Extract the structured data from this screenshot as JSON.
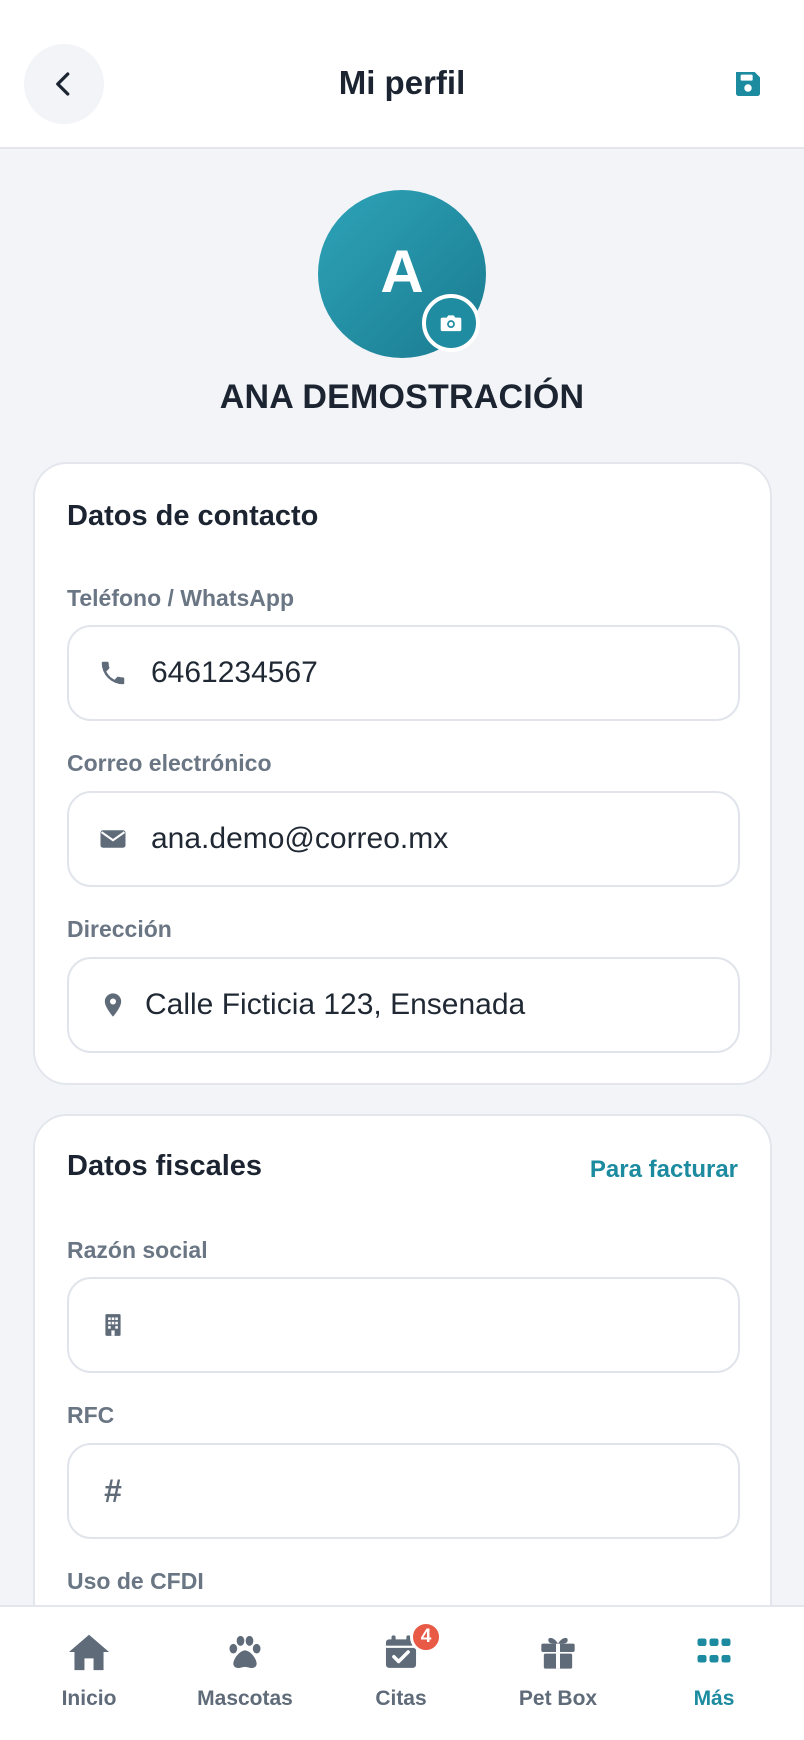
{
  "header": {
    "title": "Mi perfil",
    "back_icon": "chevron-left-icon",
    "save_icon": "save-icon"
  },
  "profile": {
    "initial": "A",
    "name": "ANA DEMOSTRACIÓN",
    "camera_icon": "camera-icon"
  },
  "contact": {
    "title": "Datos de contacto",
    "phone": {
      "label": "Teléfono / WhatsApp",
      "value": "6461234567",
      "icon": "phone-icon"
    },
    "email": {
      "label": "Correo electrónico",
      "value": "ana.demo@correo.mx",
      "icon": "envelope-icon"
    },
    "address": {
      "label": "Dirección",
      "value": "Calle Ficticia 123, Ensenada",
      "icon": "location-pin-icon"
    }
  },
  "fiscal": {
    "title": "Datos fiscales",
    "link": "Para facturar",
    "razon_social": {
      "label": "Razón social",
      "value": "",
      "icon": "building-icon"
    },
    "rfc": {
      "label": "RFC",
      "value": "",
      "icon": "hash-icon",
      "glyph": "#"
    },
    "uso_cfdi": {
      "label": "Uso de CFDI"
    }
  },
  "nav": {
    "items": [
      {
        "label": "Inicio",
        "icon": "home-icon",
        "active": false
      },
      {
        "label": "Mascotas",
        "icon": "paw-icon",
        "active": false
      },
      {
        "label": "Citas",
        "icon": "calendar-check-icon",
        "active": false,
        "badge": "4"
      },
      {
        "label": "Pet Box",
        "icon": "gift-icon",
        "active": false
      },
      {
        "label": "Más",
        "icon": "grid-icon",
        "active": true
      }
    ]
  },
  "colors": {
    "accent": "#1c8ba0",
    "badge": "#e85a45",
    "background": "#f2f4f8"
  }
}
